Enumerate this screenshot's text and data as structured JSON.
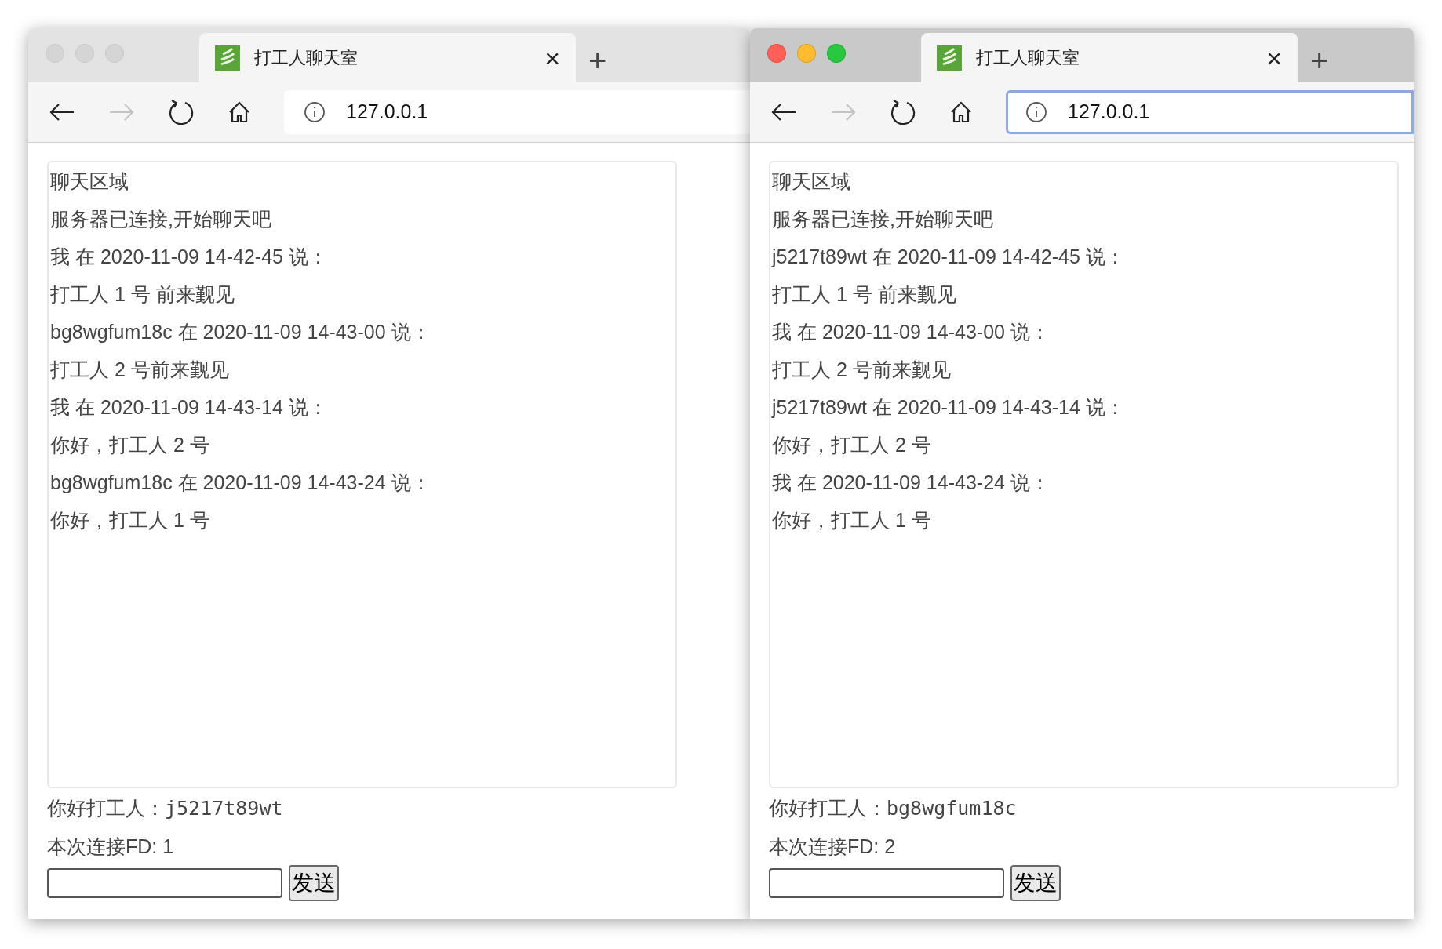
{
  "windows": [
    {
      "focused": false,
      "tab": {
        "title": "打工人聊天室",
        "close": "×",
        "new_tab": "+"
      },
      "address": "127.0.0.1",
      "chat": {
        "heading": "聊天区域",
        "lines": [
          "服务器已连接,开始聊天吧",
          "我 在 2020-11-09 14-42-45 说：",
          "打工人 1 号 前来觐见",
          "bg8wgfum18c 在 2020-11-09 14-43-00 说：",
          "打工人 2 号前来觐见",
          "我 在 2020-11-09 14-43-14 说：",
          "你好，打工人 2 号",
          "bg8wgfum18c 在 2020-11-09 14-43-24 说：",
          "你好，打工人 1 号"
        ]
      },
      "greeting": "你好打工人：",
      "username": "j5217t89wt",
      "fd": "本次连接FD: 1",
      "send_button": "发送"
    },
    {
      "focused": true,
      "tab": {
        "title": "打工人聊天室",
        "close": "×",
        "new_tab": "+"
      },
      "address": "127.0.0.1",
      "chat": {
        "heading": "聊天区域",
        "lines": [
          "服务器已连接,开始聊天吧",
          "j5217t89wt 在 2020-11-09 14-42-45 说：",
          "打工人 1 号 前来觐见",
          "我 在 2020-11-09 14-43-00 说：",
          "打工人 2 号前来觐见",
          "j5217t89wt 在 2020-11-09 14-43-14 说：",
          "你好，打工人 2 号",
          "我 在 2020-11-09 14-43-24 说：",
          "你好，打工人 1 号"
        ]
      },
      "greeting": "你好打工人：",
      "username": "bg8wgfum18c",
      "fd": "本次连接FD: 2",
      "send_button": "发送"
    }
  ]
}
